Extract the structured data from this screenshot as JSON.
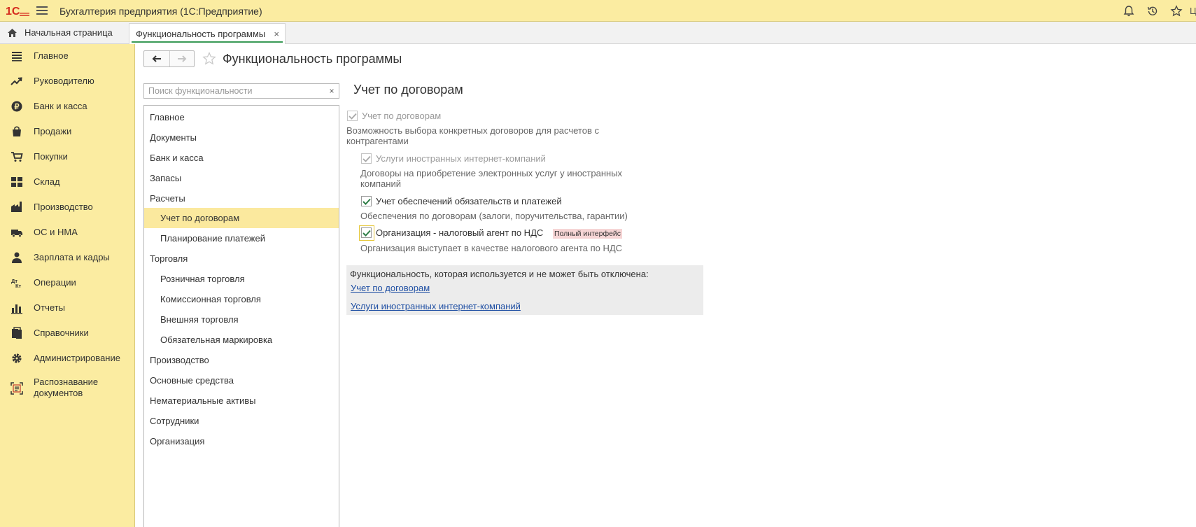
{
  "app": {
    "title": "Бухгалтерия предприятия  (1С:Предприятие)",
    "user_initial": "Ц",
    "brand_color": "#fbeca1",
    "logo_text": "1С"
  },
  "tabs": {
    "home_label": "Начальная страница",
    "active_label": "Функциональность программы",
    "close_glyph": "×"
  },
  "sidebar": {
    "items": [
      {
        "label": "Главное",
        "icon": "list-icon"
      },
      {
        "label": "Руководителю",
        "icon": "trend-icon"
      },
      {
        "label": "Банк и касса",
        "icon": "ruble-coin-icon"
      },
      {
        "label": "Продажи",
        "icon": "shopping-bag-icon"
      },
      {
        "label": "Покупки",
        "icon": "cart-icon"
      },
      {
        "label": "Склад",
        "icon": "warehouse-grid-icon"
      },
      {
        "label": "Производство",
        "icon": "factory-icon"
      },
      {
        "label": "ОС и НМА",
        "icon": "truck-icon"
      },
      {
        "label": "Зарплата и кадры",
        "icon": "person-icon"
      },
      {
        "label": "Операции",
        "icon": "debit-credit-icon"
      },
      {
        "label": "Отчеты",
        "icon": "bar-chart-icon"
      },
      {
        "label": "Справочники",
        "icon": "books-icon"
      },
      {
        "label": "Администрирование",
        "icon": "gear-icon"
      },
      {
        "label": "Распознавание документов",
        "icon": "scan-document-icon"
      }
    ]
  },
  "page": {
    "title": "Функциональность программы",
    "search_placeholder": "Поиск функциональности",
    "search_clear": "×"
  },
  "tree": {
    "items": [
      {
        "label": "Главное",
        "level": 0
      },
      {
        "label": "Документы",
        "level": 0
      },
      {
        "label": "Банк и касса",
        "level": 0
      },
      {
        "label": "Запасы",
        "level": 0
      },
      {
        "label": "Расчеты",
        "level": 0
      },
      {
        "label": "Учет по договорам",
        "level": 1,
        "selected": true
      },
      {
        "label": "Планирование платежей",
        "level": 1
      },
      {
        "label": "Торговля",
        "level": 0
      },
      {
        "label": "Розничная торговля",
        "level": 1
      },
      {
        "label": "Комиссионная торговля",
        "level": 1
      },
      {
        "label": "Внешняя торговля",
        "level": 1
      },
      {
        "label": "Обязательная маркировка",
        "level": 1
      },
      {
        "label": "Производство",
        "level": 0
      },
      {
        "label": "Основные средства",
        "level": 0
      },
      {
        "label": "Нематериальные активы",
        "level": 0
      },
      {
        "label": "Сотрудники",
        "level": 0
      },
      {
        "label": "Организация",
        "level": 0
      }
    ]
  },
  "section": {
    "title": "Учет по договорам",
    "options": [
      {
        "label": "Учет по договорам",
        "checked": true,
        "disabled": true,
        "desc_line1": "Возможность выбора конкретных договоров для расчетов с",
        "desc_line2": "контрагентами"
      },
      {
        "label": "Услуги иностранных интернет-компаний",
        "checked": true,
        "disabled": true,
        "desc_line1": "Договоры на приобретение электронных услуг у иностранных",
        "desc_line2": "компаний"
      },
      {
        "label": "Учет обеспечений обязательств и платежей",
        "checked": true,
        "disabled": false,
        "desc_line1": "Обеспечения по договорам (залоги, поручительства, гарантии)"
      },
      {
        "label": "Организация - налоговый агент по НДС",
        "checked": true,
        "disabled": false,
        "badge": "Полный интерфейс",
        "desc_line1": "Организация выступает в качестве налогового агента по НДС"
      }
    ],
    "info": {
      "text": "Функциональность, которая используется и не может быть отключена:",
      "links": [
        "Учет по договорам",
        "Услуги иностранных интернет-компаний"
      ]
    }
  }
}
